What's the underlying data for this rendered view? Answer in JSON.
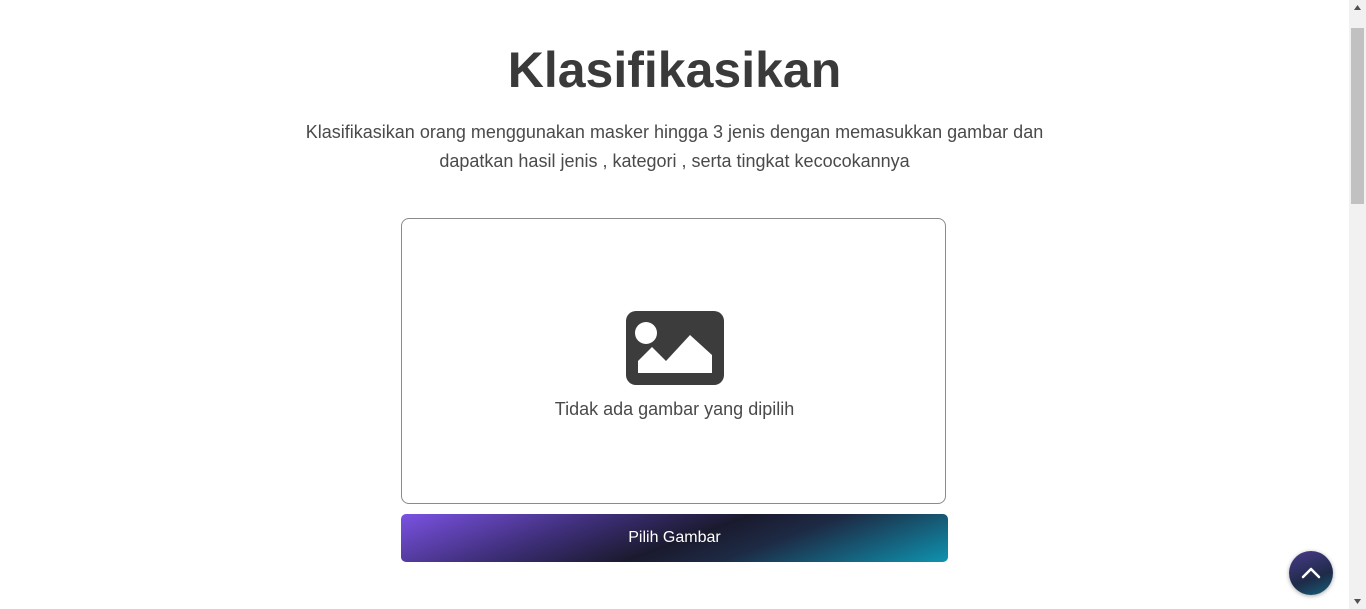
{
  "header": {
    "title": "Klasifikasikan",
    "description": "Klasifikasikan orang menggunakan masker hingga 3 jenis dengan memasukkan gambar dan dapatkan hasil jenis , kategori , serta tingkat kecocokannya"
  },
  "upload": {
    "icon": "image-icon",
    "empty_text": "Tidak ada gambar yang dipilih",
    "button_label": "Pilih Gambar"
  },
  "scroll_top": {
    "icon": "chevron-up-icon"
  },
  "colors": {
    "text": "#3a3a3a",
    "button_gradient_start": "#7b52e3",
    "button_gradient_mid": "#1a1a2e",
    "button_gradient_end": "#0e93b0",
    "icon": "#3c3c3c"
  }
}
